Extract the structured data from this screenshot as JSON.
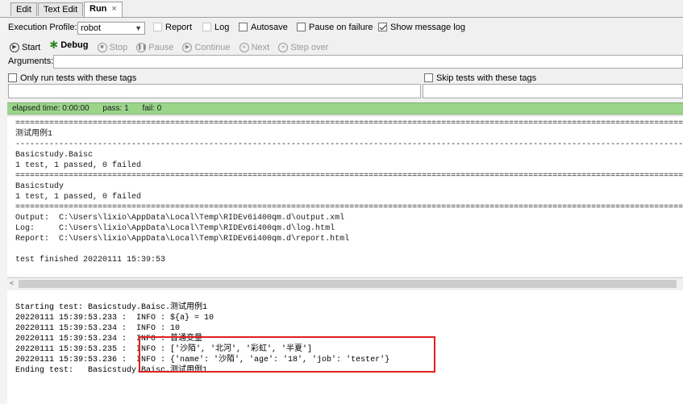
{
  "tabs": [
    {
      "label": "Edit"
    },
    {
      "label": "Text Edit"
    },
    {
      "label": "Run",
      "close": "×"
    }
  ],
  "toolbar": {
    "profile_label": "Execution Profile:",
    "profile_value": "robot",
    "report": "Report",
    "log": "Log",
    "autosave": "Autosave",
    "pause_on_failure": "Pause on failure",
    "show_message_log": "Show message log",
    "start": "Start",
    "debug": "Debug",
    "stop": "Stop",
    "pause": "Pause",
    "continue": "Continue",
    "next": "Next",
    "step_over": "Step over",
    "arguments_label": "Arguments:",
    "only_run_tags": "Only run tests with these tags",
    "skip_tags": "Skip tests with these tags"
  },
  "status": {
    "elapsed": "elapsed time: 0:00:00",
    "pass": "pass: 1",
    "fail": "fail: 0"
  },
  "output_lines": [
    "==============================================================================================================================================",
    "测试用例1",
    "----------------------------------------------------------------------------------------------------------------------------------------------",
    "Basicstudy.Baisc",
    "1 test, 1 passed, 0 failed",
    "==============================================================================================================================================",
    "Basicstudy",
    "1 test, 1 passed, 0 failed",
    "==============================================================================================================================================",
    "Output:  C:\\Users\\lixio\\AppData\\Local\\Temp\\RIDEv6i400qm.d\\output.xml",
    "Log:     C:\\Users\\lixio\\AppData\\Local\\Temp\\RIDEv6i400qm.d\\log.html",
    "Report:  C:\\Users\\lixio\\AppData\\Local\\Temp\\RIDEv6i400qm.d\\report.html",
    "",
    "test finished 20220111 15:39:53"
  ],
  "log_lines": [
    "Starting test: Basicstudy.Baisc.测试用例1",
    "20220111 15:39:53.233 :  INFO : ${a} = 10",
    "20220111 15:39:53.234 :  INFO : 10",
    "20220111 15:39:53.234 :  INFO : 普通变量",
    "20220111 15:39:53.235 :  INFO : ['沙陌', '北河', '彩虹', '半夏']",
    "20220111 15:39:53.236 :  INFO : {'name': '沙陌', 'age': '18', 'job': 'tester'}",
    "Ending test:   Basicstudy.Baisc.测试用例1"
  ],
  "colors": {
    "status_green": "#9bd58a",
    "highlight_red": "#e02020"
  }
}
